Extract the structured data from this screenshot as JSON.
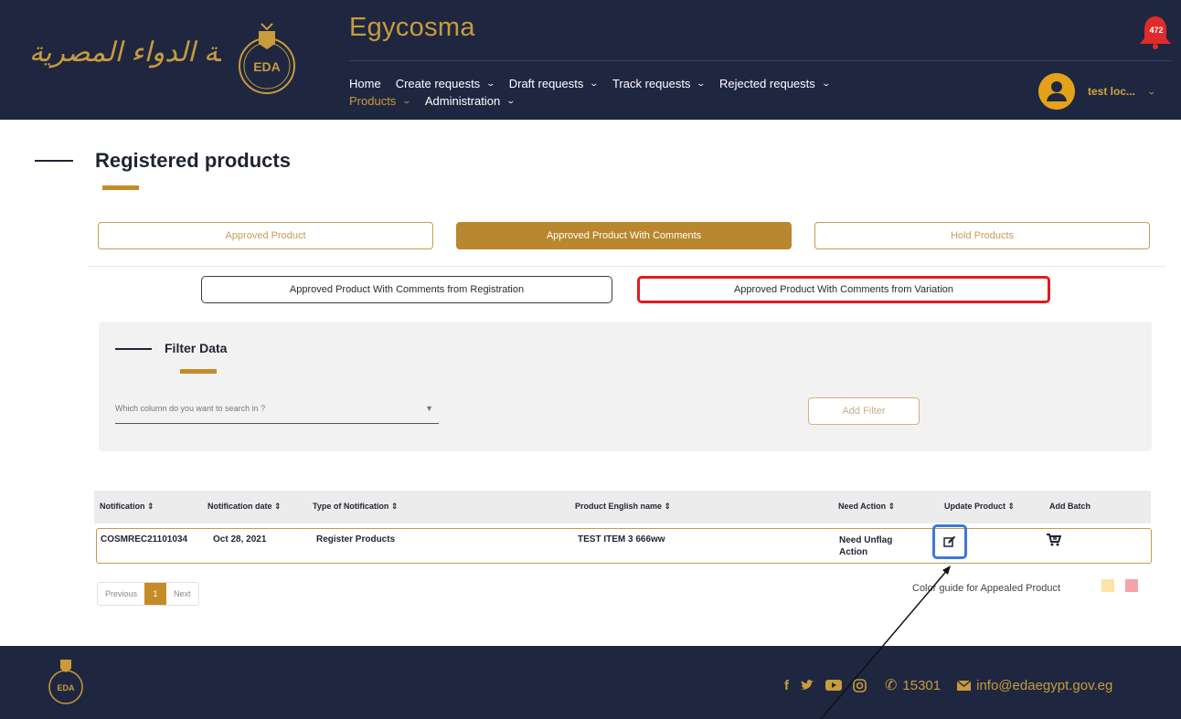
{
  "header": {
    "arabic_logo_text": "هيئة الدواء المصرية",
    "app_title": "Egycosma",
    "notification_count": "472",
    "user_name": "test loc...",
    "nav_row1": [
      {
        "label": "Home"
      },
      {
        "label": "Create requests"
      },
      {
        "label": "Draft requests"
      },
      {
        "label": "Track requests"
      },
      {
        "label": "Rejected requests"
      }
    ],
    "nav_row2": [
      {
        "label": "Products"
      },
      {
        "label": "Administration"
      }
    ]
  },
  "page": {
    "title": "Registered products"
  },
  "tabs": [
    {
      "label": "Approved Product"
    },
    {
      "label": "Approved Product With Comments"
    },
    {
      "label": "Hold Products"
    }
  ],
  "subtabs": [
    {
      "label": "Approved Product With Comments from Registration"
    },
    {
      "label": "Approved Product With Comments from Variation"
    }
  ],
  "filter": {
    "title": "Filter Data",
    "select_placeholder": "Which column do you want to search in ?",
    "add_filter_label": "Add Filter"
  },
  "table": {
    "columns": [
      "Notification ⇕",
      "Notification date ⇕",
      "Type of Notification ⇕",
      "Product English name ⇕",
      "Need Action ⇕",
      "Update Product ⇕",
      "Add Batch"
    ],
    "rows": [
      {
        "notification": "COSMREC21101034",
        "date": "Oct 28, 2021",
        "type": "Register Products",
        "product_name": "TEST ITEM 3 666ww",
        "need_action": "Need Unflag Action"
      }
    ]
  },
  "pagination": {
    "previous": "Previous",
    "current": "1",
    "next": "Next"
  },
  "color_guide": {
    "label": "Color guide for Appealed Product",
    "colors": [
      "#fde3a7",
      "#f5a3a8"
    ]
  },
  "footer": {
    "phone": "15301",
    "email": "info@edaegypt.gov.eg"
  },
  "colors": {
    "navy": "#1f2740",
    "gold": "#c89b3c",
    "highlight_red": "#e21b1b",
    "highlight_blue": "#3b7ad0"
  }
}
